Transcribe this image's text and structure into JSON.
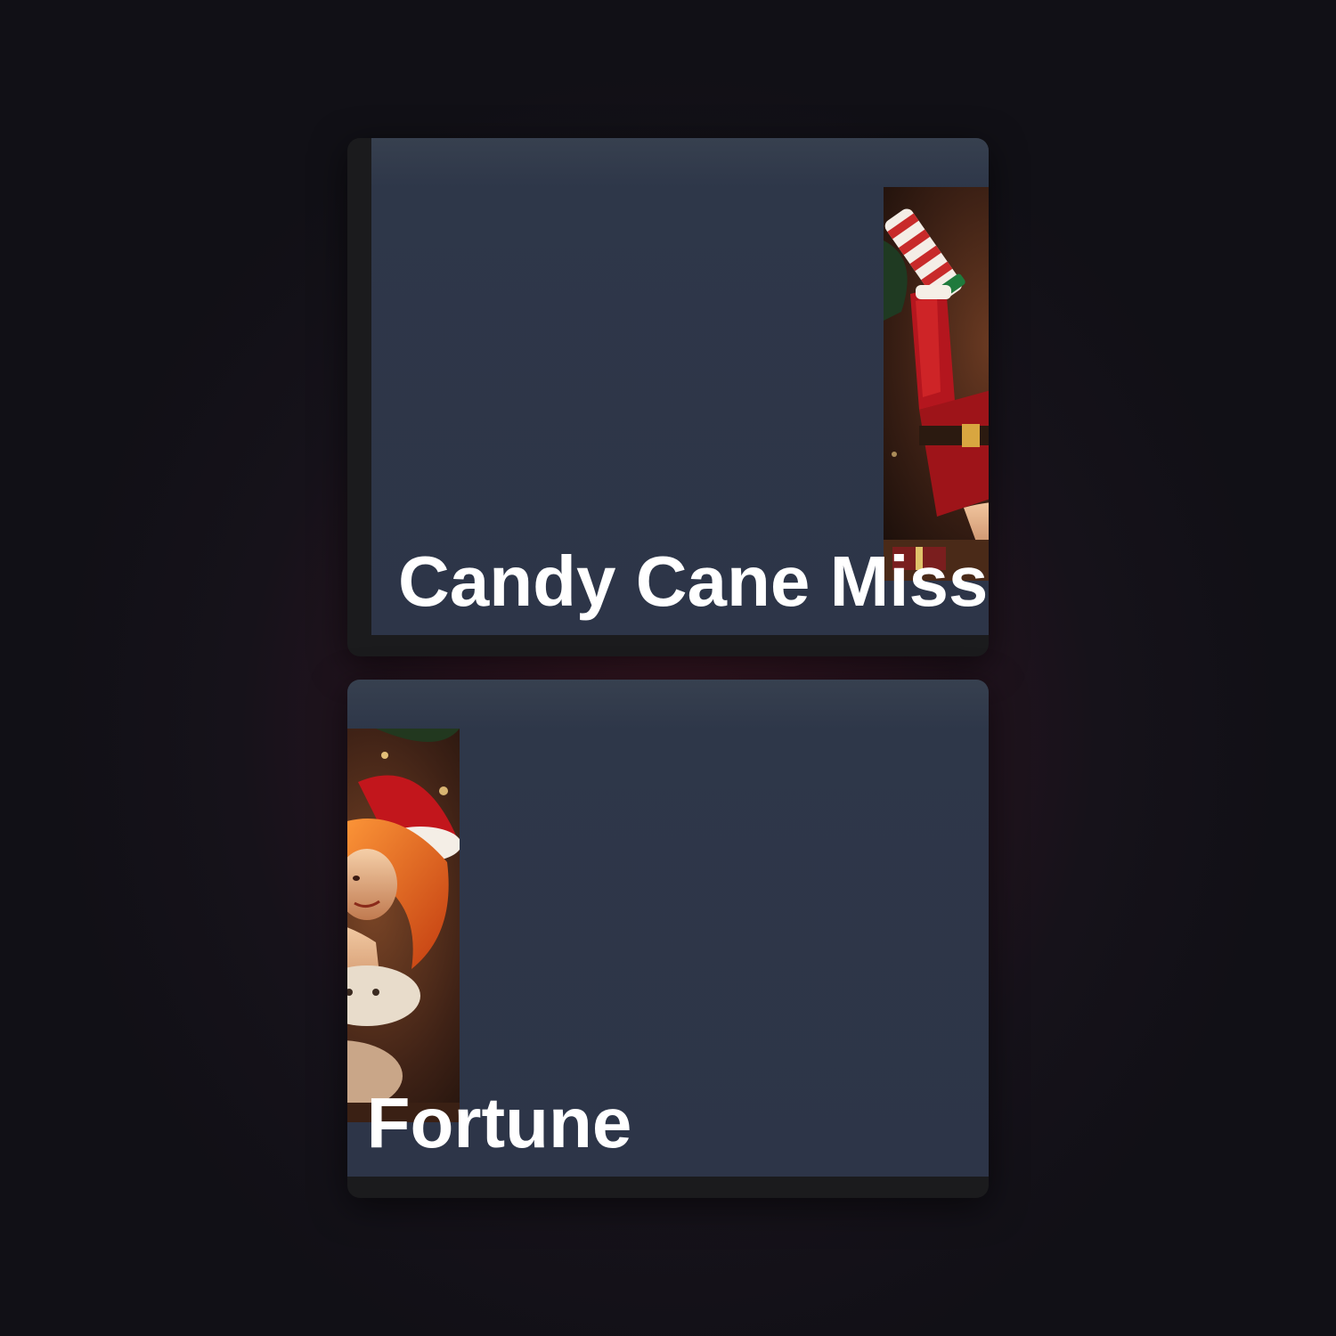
{
  "skin_card": {
    "title": "Candy Cane Miss Fortune",
    "art": {
      "icon": "candy-cane-miss-fortune-splash",
      "colors": {
        "card_bg": "#2d3548",
        "title_text": "#ffffff",
        "frame": "#1b1b1d"
      }
    }
  }
}
